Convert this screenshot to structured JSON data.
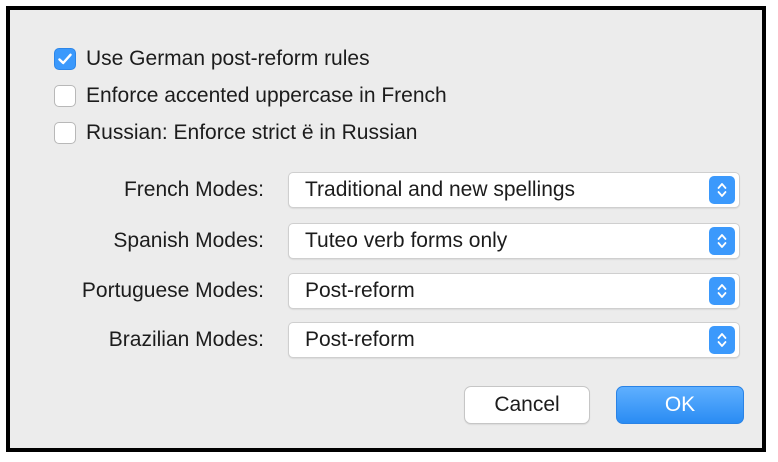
{
  "options": [
    {
      "label": "Use German post-reform rules",
      "checked": true
    },
    {
      "label": "Enforce accented uppercase in French",
      "checked": false
    },
    {
      "label": "Russian: Enforce strict ë in Russian",
      "checked": false
    }
  ],
  "modes": [
    {
      "label": "French Modes:",
      "value": "Traditional and new spellings"
    },
    {
      "label": "Spanish Modes:",
      "value": "Tuteo verb forms only"
    },
    {
      "label": "Portuguese Modes:",
      "value": "Post-reform"
    },
    {
      "label": "Brazilian Modes:",
      "value": "Post-reform"
    }
  ],
  "buttons": {
    "cancel_label": "Cancel",
    "ok_label": "OK"
  },
  "colors": {
    "accent": "#3b99fc",
    "background": "#ececec",
    "border": "#000000"
  }
}
